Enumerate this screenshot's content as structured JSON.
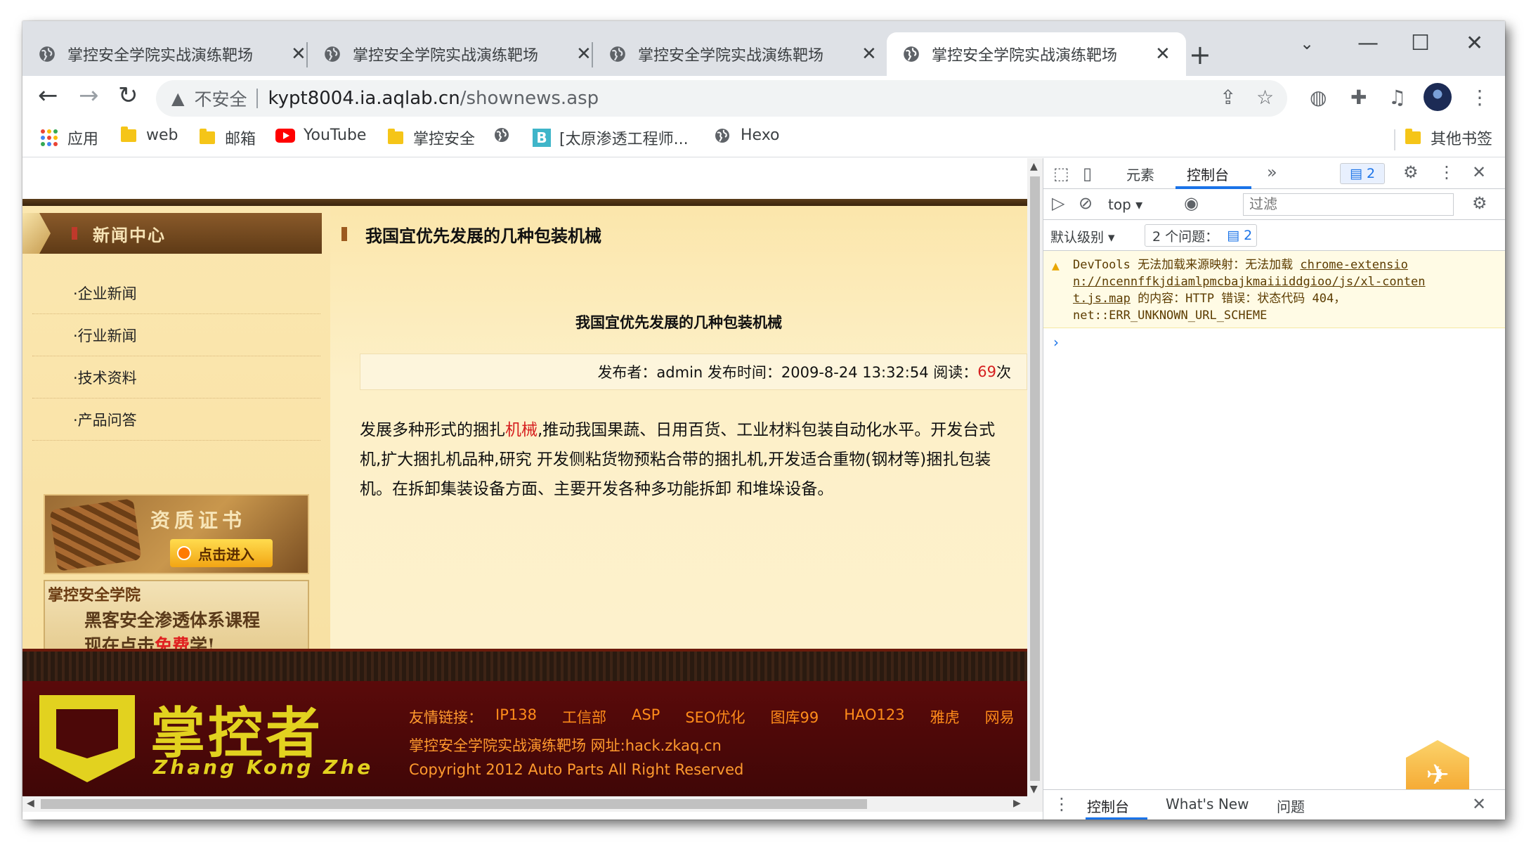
{
  "tabs": [
    {
      "title": "掌控安全学院实战演练靶场",
      "active": false
    },
    {
      "title": "掌控安全学院实战演练靶场",
      "active": false
    },
    {
      "title": "掌控安全学院实战演练靶场",
      "active": false
    },
    {
      "title": "掌控安全学院实战演练靶场",
      "active": true
    }
  ],
  "address": {
    "security_label": "不安全",
    "host": "kypt8004.ia.aqlab.cn",
    "path": "/shownews.asp"
  },
  "bookmarks": [
    {
      "label": "应用",
      "icon": "apps-icon"
    },
    {
      "label": "web",
      "icon": "folder-icon"
    },
    {
      "label": "邮箱",
      "icon": "folder-icon"
    },
    {
      "label": "YouTube",
      "icon": "youtube-icon"
    },
    {
      "label": "掌控安全",
      "icon": "folder-icon"
    },
    {
      "label": "",
      "icon": "globe-icon"
    },
    {
      "label": "[太原渗透工程师...",
      "icon": "b-icon"
    },
    {
      "label": "Hexo",
      "icon": "globe-icon"
    },
    {
      "label": "其他书签",
      "icon": "folder-icon"
    }
  ],
  "page": {
    "sidebar_title": "新闻中心",
    "categories": [
      "·企业新闻",
      "·行业新闻",
      "·技术资料",
      "·产品问答"
    ],
    "cert_title": "资质证书",
    "cert_button": "点击进入",
    "course_school": "掌控安全学院",
    "course_line1": "黑客安全渗透体系课程",
    "course_line2_pre": "现在点击",
    "course_line2_free": "免费",
    "course_line2_post": "学!",
    "article_header": "我国宜优先发展的几种包装机械",
    "article_title": "我国宜优先发展的几种包装机械",
    "meta_prefix": "发布者：admin 发布时间：2009-8-24 13:32:54 阅读：",
    "meta_hits": "69",
    "meta_suffix": "次",
    "body_line1_pre": "发展多种形式的捆扎",
    "body_line1_kw": "机械",
    "body_line1_post": ",推动我国果蔬、日用百货、工业材料包装自动化水平。开发台式",
    "body_line2": "机,扩大捆扎机品种,研究 开发侧粘货物预粘合带的捆扎机,开发适合重物(钢材等)捆扎包装",
    "body_line3": "机。在拆卸集装设备方面、主要开发各种多功能拆卸 和堆垛设备。",
    "logo_cn": "掌控者",
    "logo_en": "Zhang Kong Zhe",
    "links_lead": "友情链接：",
    "links": [
      "IP138",
      "工信部",
      "ASP",
      "SEO优化",
      "图库99",
      "HAO123",
      "雅虎",
      "网易"
    ],
    "footer_line1": "掌控安全学院实战演练靶场 网址:hack.zkaq.cn",
    "footer_line2": "Copyright 2012 Auto Parts All Right Reserved"
  },
  "devtools": {
    "tab_elements": "元素",
    "tab_console": "控制台",
    "issue_badge": "2",
    "context": "top",
    "filter_placeholder": "过滤",
    "level": "默认级别",
    "issues_label": "2 个问题：",
    "issues_count": "2",
    "warning_line1_pre": "DevTools 无法加载来源映射：无法加载 ",
    "warning_line1_link": "chrome-extensio",
    "warning_line2_link": "n://ncennffkjdiamlpmcbajkmaiiiddgioo/js/xl-conten",
    "warning_line3_link": "t.js.map",
    "warning_line3_post": " 的内容：HTTP 错误：状态代码 404，",
    "warning_line4": "net::ERR_UNKNOWN_URL_SCHEME",
    "drawer_console": "控制台",
    "drawer_whatsnew": "What's New",
    "drawer_issues": "问题"
  },
  "colors": {
    "accent": "#1a73e8",
    "link_orange": "#ff8c1a",
    "highlight_red": "#d62020",
    "logo_yellow": "#e2d21f"
  }
}
